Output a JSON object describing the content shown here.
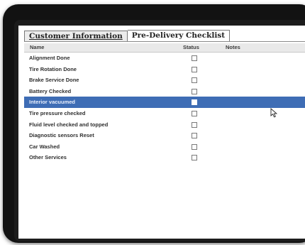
{
  "tabs": [
    {
      "label": "Customer Information",
      "active": false
    },
    {
      "label": "Pre-Delivery Checklist",
      "active": true
    }
  ],
  "grid": {
    "columns": {
      "name": "Name",
      "status": "Status",
      "notes": "Notes"
    },
    "rows": [
      {
        "label": "Alignment Done",
        "checked": false,
        "selected": false
      },
      {
        "label": "Tire Rotation Done",
        "checked": false,
        "selected": false
      },
      {
        "label": "Brake Service Done",
        "checked": false,
        "selected": false
      },
      {
        "label": "Battery Checked",
        "checked": false,
        "selected": false
      },
      {
        "label": "Interior vacuumed",
        "checked": false,
        "selected": true
      },
      {
        "label": "Tire pressure checked",
        "checked": false,
        "selected": false
      },
      {
        "label": "Fluid level checked and topped",
        "checked": false,
        "selected": false
      },
      {
        "label": "Diagnostic sensors Reset",
        "checked": false,
        "selected": false
      },
      {
        "label": "Car Washed",
        "checked": false,
        "selected": false
      },
      {
        "label": "Other Services",
        "checked": false,
        "selected": false
      }
    ]
  },
  "colors": {
    "selection": "#3e6db5",
    "bezel": "#121212"
  },
  "icons": {
    "cursor": "mouse-pointer-icon"
  }
}
